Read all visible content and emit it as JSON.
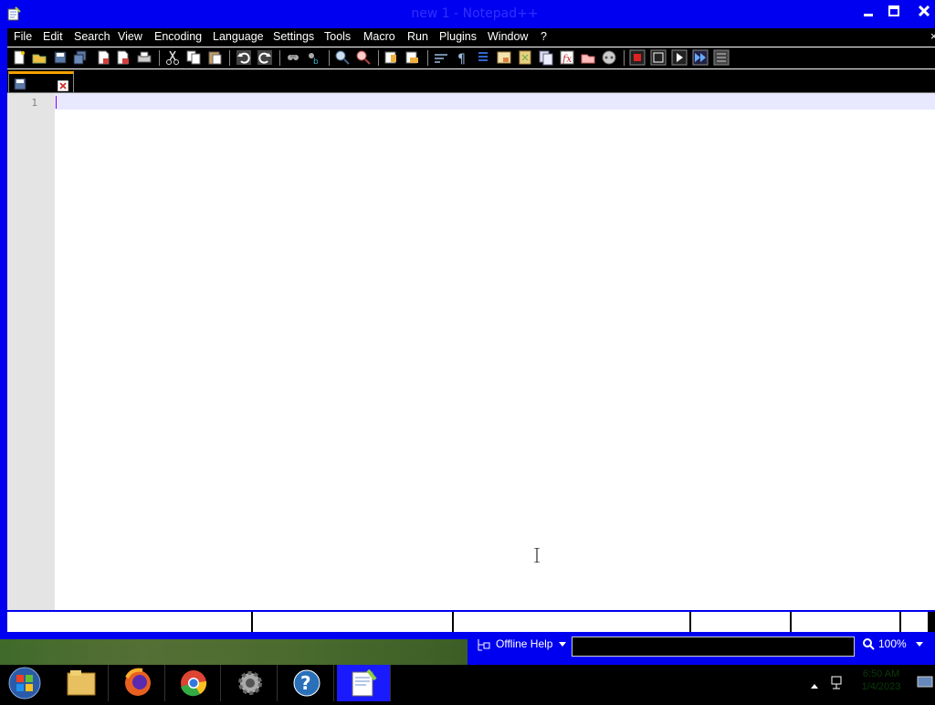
{
  "window": {
    "title": "new 1 - Notepad++"
  },
  "menu": [
    "File",
    "Edit",
    "Search",
    "View",
    "Encoding",
    "Language",
    "Settings",
    "Tools",
    "Macro",
    "Run",
    "Plugins",
    "Window",
    "?"
  ],
  "editor": {
    "line_number": "1",
    "content": ""
  },
  "help": {
    "label": "Offline Help",
    "search_value": ""
  },
  "zoom": {
    "level": "100%"
  },
  "taskbar": {
    "items": [
      "start-orb",
      "file-explorer",
      "firefox",
      "chrome",
      "settings",
      "help",
      "notepadpp"
    ],
    "clock_time": "6:50 AM",
    "clock_date": "1/4/2023"
  },
  "colors": {
    "title_bar": "#0000f0",
    "tab_accent": "#f5a000",
    "current_line": "#e8e8ff"
  }
}
